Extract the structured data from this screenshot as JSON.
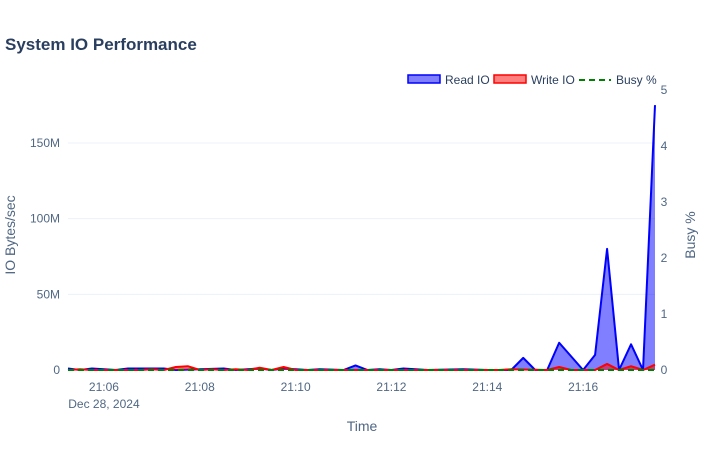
{
  "title": "System IO Performance",
  "chart_data": {
    "type": "area",
    "title": "System IO Performance",
    "xlabel": "Time",
    "ylabel": "IO Bytes/sec",
    "y2label": "Busy %",
    "date_label": "Dec 28, 2024",
    "x_range": [
      "21:05:15",
      "21:17:30"
    ],
    "x_ticks": [
      "21:06",
      "21:08",
      "21:10",
      "21:12",
      "21:14",
      "21:16"
    ],
    "ylim": [
      0,
      185000000
    ],
    "y_ticks": [
      {
        "value": 0,
        "label": "0"
      },
      {
        "value": 50000000,
        "label": "50M"
      },
      {
        "value": 100000000,
        "label": "100M"
      },
      {
        "value": 150000000,
        "label": "150M"
      }
    ],
    "y2lim": [
      0,
      5
    ],
    "y2_ticks": [
      "0",
      "1",
      "2",
      "3",
      "4",
      "5"
    ],
    "legend_position": "top-right",
    "series": [
      {
        "name": "Read IO",
        "color": "#0000ff",
        "fill": "rgba(0,0,255,0.5)",
        "x": [
          "21:05:15",
          "21:05:30",
          "21:05:45",
          "21:06:15",
          "21:06:30",
          "21:07:15",
          "21:07:30",
          "21:08:30",
          "21:08:45",
          "21:09:15",
          "21:09:30",
          "21:09:45",
          "21:10:15",
          "21:10:30",
          "21:11:00",
          "21:11:15",
          "21:11:30",
          "21:11:45",
          "21:12:00",
          "21:12:15",
          "21:12:30",
          "21:12:45",
          "21:13:30",
          "21:14:00",
          "21:14:30",
          "21:14:45",
          "21:15:00",
          "21:15:15",
          "21:15:30",
          "21:16:00",
          "21:16:15",
          "21:16:30",
          "21:16:45",
          "21:17:00",
          "21:17:15",
          "21:17:30"
        ],
        "values": [
          1000000,
          0,
          1000000,
          0,
          1000000,
          1000000,
          0,
          1000000,
          0,
          1000000,
          0,
          1000000,
          0,
          500000,
          0,
          3000000,
          0,
          500000,
          0,
          1000000,
          500000,
          0,
          500000,
          0,
          0,
          8000000,
          0,
          0,
          18000000,
          0,
          10000000,
          80000000,
          0,
          17000000,
          0,
          175000000
        ]
      },
      {
        "name": "Write IO",
        "color": "#ff0000",
        "fill": "rgba(255,0,0,0.5)",
        "x": [
          "21:05:15",
          "21:05:30",
          "21:05:45",
          "21:06:45",
          "21:07:00",
          "21:07:15",
          "21:07:30",
          "21:07:45",
          "21:08:00",
          "21:08:15",
          "21:08:30",
          "21:08:45",
          "21:09:00",
          "21:09:15",
          "21:09:30",
          "21:09:45",
          "21:10:00",
          "21:14:15",
          "21:14:30",
          "21:15:15",
          "21:15:30",
          "21:15:45",
          "21:16:15",
          "21:16:30",
          "21:16:45",
          "21:17:00",
          "21:17:15",
          "21:17:30"
        ],
        "values": [
          0,
          500000,
          0,
          0,
          500000,
          0,
          2000000,
          2500000,
          0,
          500000,
          0,
          500000,
          0,
          1500000,
          0,
          2000000,
          0,
          0,
          500000,
          0,
          2000000,
          0,
          0,
          4000000,
          0,
          2500000,
          0,
          3500000
        ]
      },
      {
        "name": "Busy %",
        "color": "#008000",
        "dash": "dashed",
        "axis": "y2",
        "x": [
          "21:05:15",
          "21:17:30"
        ],
        "values": [
          0,
          0
        ]
      }
    ]
  }
}
